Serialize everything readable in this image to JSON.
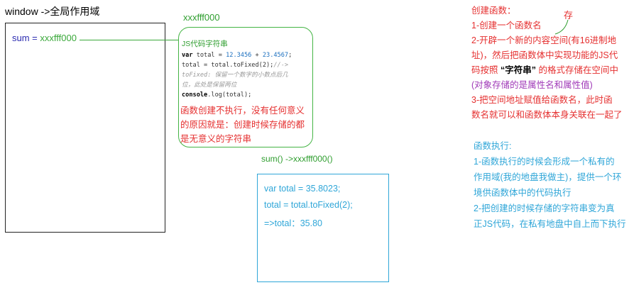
{
  "window": {
    "title": "window ->全局作用域",
    "sum_name": "sum",
    "sum_eq": " = ",
    "sum_ref": "xxxfff000"
  },
  "heap": {
    "address": "xxxfff000",
    "title": "JS代码字符串",
    "code": {
      "l1_kw": "var",
      "l1_a": " total = ",
      "l1_n1": "12.3456",
      "l1_b": " + ",
      "l1_n2": "23.4567",
      "l1_c": ";",
      "l2_a": "total = total.",
      "l2_fn": "toFixed",
      "l2_b": "(2);",
      "l2_cm": "//->",
      "l3_cm": "toFixed: 保留一个数字的小数点后几",
      "l4_cm": "位，此处是保留两位",
      "l5_kw": "console",
      "l5_a": ".log(total);"
    },
    "note": [
      "函数创建不执行，没有任何意义",
      "的原因就是：创建时候存储的都",
      "是无意义的字符串"
    ]
  },
  "call": {
    "label": "sum() ->xxxfff000()",
    "lines": [
      "var total =  35.8023;",
      "total = total.toFixed(2);",
      "=>total：35.80"
    ]
  },
  "create_notes": {
    "lines": [
      "创建函数：",
      "  1-创建一个函数名",
      "  2-开辟一个新的内容空间(有16进制地",
      "址)，然后把函数体中实现功能的JS代",
      "码按照 ",
      "(对象存储的是属性名和属性值)",
      "  3-把空间地址赋值给函数名，此时函",
      "数名就可以和函数体本身关联在一起了"
    ],
    "line5_bold": "“字符串”",
    "line5_tail": " 的格式存储在空间中",
    "annot": "存"
  },
  "exec_notes": {
    "lines": [
      "函数执行:",
      "  1-函数执行的时候会形成一个私有的",
      "作用域(我的地盘我做主)，提供一个环",
      "境供函数体中的代码执行",
      "  2-把创建的时候存储的字符串变为真",
      "正JS代码，在私有地盘中自上而下执行"
    ]
  },
  "colors": {
    "red": "#e53030",
    "green": "#2f9e2f",
    "blue": "#2fa6d8",
    "purple": "#a03ab8",
    "navy": "#2b2bb0"
  }
}
